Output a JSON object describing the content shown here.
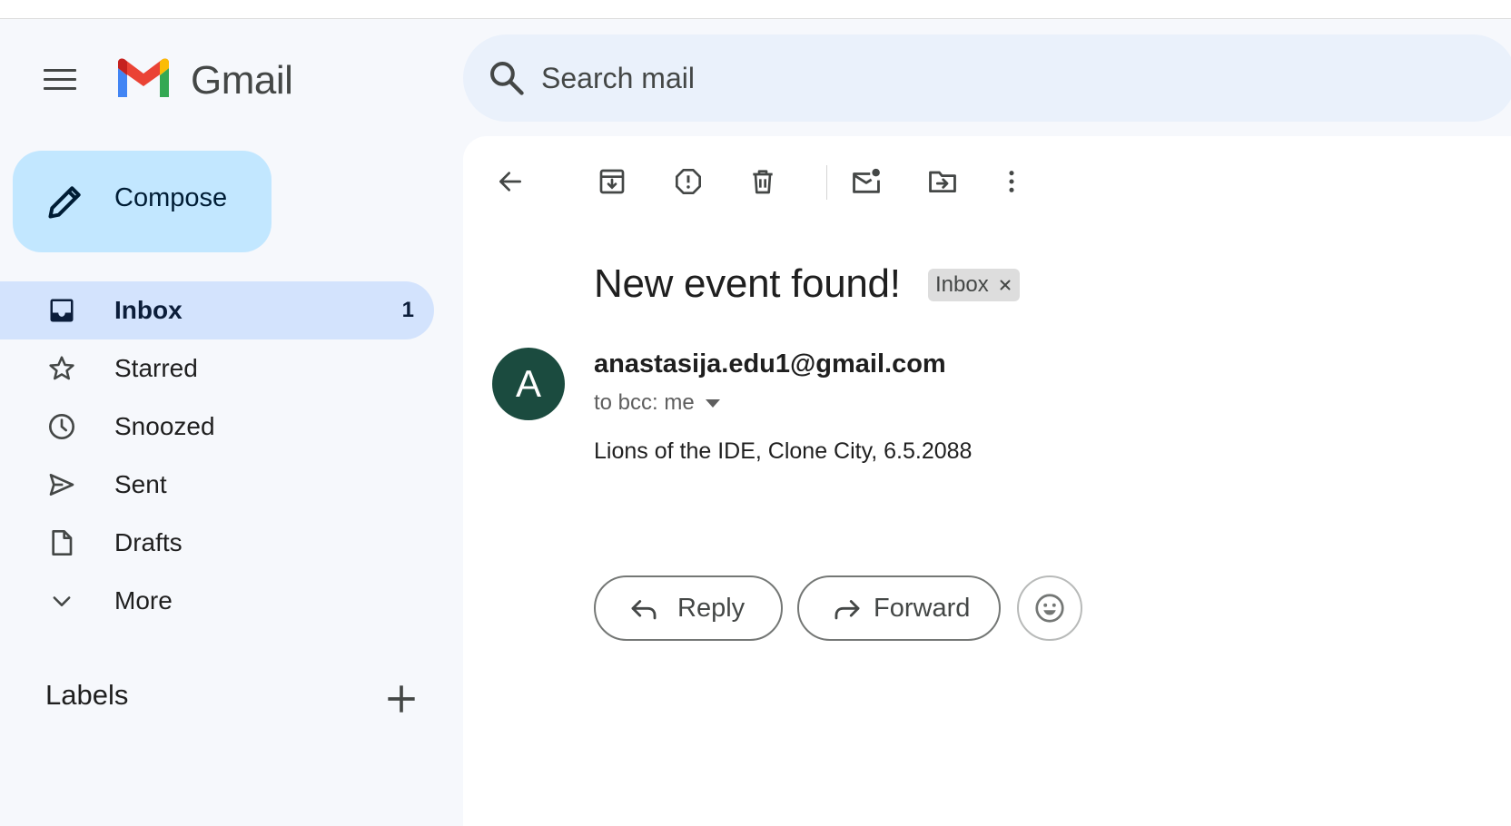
{
  "app": {
    "brand": "Gmail"
  },
  "search": {
    "placeholder": "Search mail"
  },
  "sidebar": {
    "compose_label": "Compose",
    "items": [
      {
        "label": "Inbox",
        "count": "1",
        "icon": "inbox-icon",
        "active": true
      },
      {
        "label": "Starred",
        "icon": "star-icon"
      },
      {
        "label": "Snoozed",
        "icon": "clock-icon"
      },
      {
        "label": "Sent",
        "icon": "send-icon"
      },
      {
        "label": "Drafts",
        "icon": "draft-icon"
      },
      {
        "label": "More",
        "icon": "chevron-down-icon"
      }
    ],
    "labels_title": "Labels"
  },
  "message": {
    "subject": "New event found!",
    "label_chip": "Inbox",
    "avatar_letter": "A",
    "sender": "anastasija.edu1@gmail.com",
    "recipient": "to bcc: me",
    "body": "Lions of the IDE, Clone City, 6.5.2088",
    "reply_label": "Reply",
    "forward_label": "Forward"
  },
  "colors": {
    "background": "#f6f8fc",
    "search_bg": "#eaf1fb",
    "compose_bg": "#c2e7ff",
    "active_nav_bg": "#d3e3fd",
    "avatar_bg": "#1b4b3f"
  }
}
